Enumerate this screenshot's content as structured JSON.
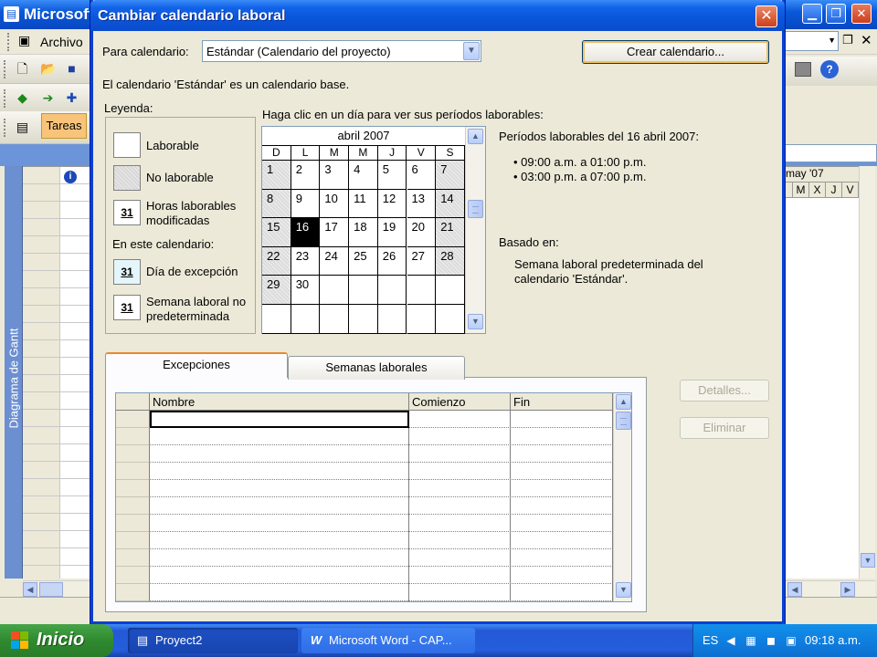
{
  "app": {
    "title": "Microsoft",
    "menu_label": "Archivo",
    "tasks_label": "Tareas",
    "side_label": "Diagrama de Gantt",
    "gantt_month": "may '07",
    "gantt_days": [
      "",
      "M",
      "X",
      "J",
      "V"
    ]
  },
  "dialog": {
    "title": "Cambiar calendario laboral",
    "for_calendar_label": "Para calendario:",
    "calendar_value": "Estándar (Calendario del proyecto)",
    "create_button": "Crear calendario...",
    "base_note": "El calendario 'Estándar' es un calendario base.",
    "legend_title": "Leyenda:",
    "legend": {
      "working": "Laborable",
      "nonworking": "No laborable",
      "modified_hours_line1": "Horas laborables",
      "modified_hours_line2": "modificadas",
      "in_this_calendar": "En este calendario:",
      "exception_day": "Día de excepción",
      "nondefault_week_line1": "Semana laboral no",
      "nondefault_week_line2": "predeterminada",
      "sample_day": "31"
    },
    "calendar_hint": "Haga clic en un día para ver sus períodos laborables:",
    "calendar": {
      "month": "abril 2007",
      "dow": [
        "D",
        "L",
        "M",
        "M",
        "J",
        "V",
        "S"
      ],
      "weeks": [
        [
          "1",
          "2",
          "3",
          "4",
          "5",
          "6",
          "7"
        ],
        [
          "8",
          "9",
          "10",
          "11",
          "12",
          "13",
          "14"
        ],
        [
          "15",
          "16",
          "17",
          "18",
          "19",
          "20",
          "21"
        ],
        [
          "22",
          "23",
          "24",
          "25",
          "26",
          "27",
          "28"
        ],
        [
          "29",
          "30",
          "",
          "",
          "",
          "",
          ""
        ],
        [
          "",
          "",
          "",
          "",
          "",
          "",
          ""
        ]
      ],
      "selected_day": "16"
    },
    "periods_title": "Períodos laborables del 16 abril 2007:",
    "periods": [
      "09:00 a.m. a 01:00 p.m.",
      "03:00 p.m. a 07:00 p.m."
    ],
    "based_on_label": "Basado en:",
    "based_on_line1": "Semana laboral predeterminada del",
    "based_on_line2": "calendario 'Estándar'.",
    "tabs": [
      "Excepciones",
      "Semanas laborales"
    ],
    "columns": [
      "Nombre",
      "Comienzo",
      "Fin"
    ],
    "details_button": "Detalles...",
    "delete_button": "Eliminar"
  },
  "taskbar": {
    "start_label": "Inicio",
    "tasks": [
      "Proyect2",
      "Microsoft Word - CAP..."
    ],
    "language": "ES",
    "clock": "09:18 a.m."
  },
  "colors": {
    "xp_blue": "#0a55da",
    "start_green": "#2f8a2f",
    "nonworking_gray": "#dcdcdc",
    "selected_day": "#000000",
    "exception_day": "#e4f6fc"
  },
  "icons": [
    "close-icon",
    "dropdown-arrow-icon",
    "scroll-up-icon",
    "scroll-down-icon",
    "windows-flag-icon",
    "info-icon",
    "help-icon"
  ]
}
